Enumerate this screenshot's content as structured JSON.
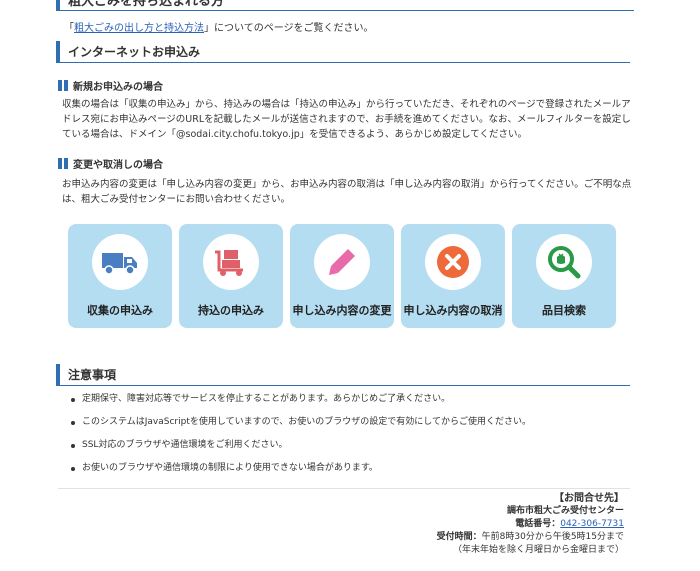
{
  "top_heading": "粗大ごみを持ち込まれる方",
  "intro": {
    "link": "粗大ごみの出し方と持込方法",
    "prefix": "「",
    "suffix": "」についてのページをご覧ください。"
  },
  "internet": {
    "heading": "インターネットお申込み",
    "new_heading": "新規お申込みの場合",
    "new_text": "収集の場合は「収集の申込み」から、持込みの場合は「持込の申込み」から行っていただき、それぞれのページで登録されたメールアドレス宛にお申込みページのURLを記載したメールが送信されますので、お手続を進めてください。なお、メールフィルターを設定している場合は、ドメイン「@sodai.city.chofu.tokyo.jp」を受信できるよう、あらかじめ設定してください。",
    "change_heading": "変更や取消しの場合",
    "change_text": "お申込み内容の変更は「申し込み内容の変更」から、お申込み内容の取消は「申し込み内容の取消」から行ってください。ご不明な点は、粗大ごみ受付センターにお問い合わせください。"
  },
  "tiles": [
    {
      "icon": "truck-icon",
      "label": "収集の申込み"
    },
    {
      "icon": "cart-icon",
      "label": "持込の申込み"
    },
    {
      "icon": "pencil-icon",
      "label": "申し込み内容の変更"
    },
    {
      "icon": "cross-icon",
      "label": "申し込み内容の取消"
    },
    {
      "icon": "search-bag-icon",
      "label": "品目検索"
    }
  ],
  "notes": {
    "heading": "注意事項",
    "items": [
      "定期保守、障害対応等でサービスを停止することがあります。あらかじめご了承ください。",
      "このシステムはJavaScriptを使用していますので、お使いのブラウザの設定で有効にしてからご使用ください。",
      "SSL対応のブラウザや通信環境をご利用ください。",
      "お使いのブラウザや通信環境の制限により使用できない場合があります。"
    ]
  },
  "contact": {
    "title": "【お問合せ先】",
    "org": "調布市粗大ごみ受付センター",
    "phone_label": "電話番号：",
    "phone": "042-306-7731",
    "hours_label": "受付時間：",
    "hours": "午前8時30分から午後5時15分まで",
    "hours_note": "（年末年始を除く月曜日から金曜日まで）"
  },
  "colors": {
    "accent": "#2d6fb0",
    "tile_bg": "#b4ddf2",
    "truck": "#4a7ec2",
    "cart": "#e0606a",
    "pencil": "#e86aa8",
    "cross": "#ee6a3a",
    "search": "#2a9a48"
  }
}
